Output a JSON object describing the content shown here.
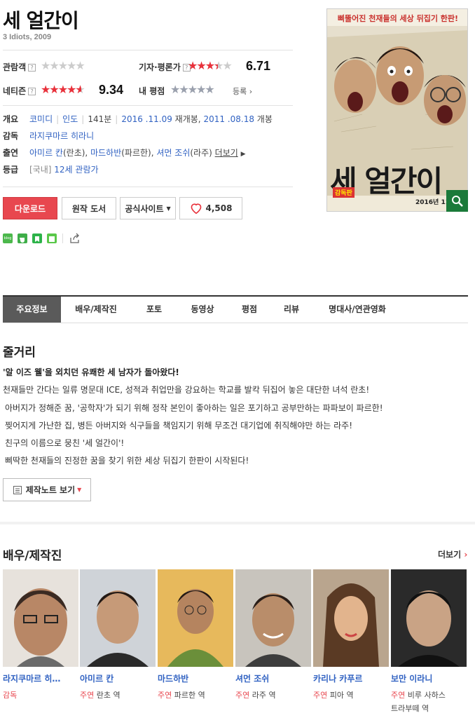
{
  "movie": {
    "title": "세 얼간이",
    "subtitle": "3 Idiots, 2009"
  },
  "ratings": {
    "audience_label": "관람객",
    "audience_q": "?",
    "critic_label": "기자·평론가",
    "critic_q": "?",
    "critic_score": "6.71",
    "critic_stars": 3.5,
    "netizen_label": "네티즌",
    "netizen_q": "?",
    "netizen_score": "9.34",
    "netizen_stars": 4.7,
    "my_label": "내 평점",
    "register": "등록"
  },
  "info": {
    "overview_label": "개요",
    "genre": "코미디",
    "country": "인도",
    "runtime": "141분",
    "release1": "2016 .11.09",
    "release1_suffix": "재개봉,",
    "release2": "2011 .08.18",
    "release2_suffix": "개봉",
    "director_label": "감독",
    "director": "라지쿠마르 히라니",
    "cast_label": "출연",
    "cast1": "아미르 칸",
    "cast1_role": "(란초),",
    "cast2": "마드하반",
    "cast2_role": "(파르한),",
    "cast3": "셔먼 조쉬",
    "cast3_role": "(라주)",
    "more": "더보기",
    "rating_label": "등급",
    "rating_country": "[국내]",
    "rating": "12세 관람가"
  },
  "buttons": {
    "download": "다운로드",
    "original": "원작 도서",
    "official": "공식사이트",
    "likes": "4,508"
  },
  "share": {
    "blog": "blog"
  },
  "poster": {
    "tagline": "삐뚤어진 천재들의 세상 뒤집기 한판!",
    "title": "세 얼간이",
    "badge": "감독판",
    "date": "2016년 11월"
  },
  "tabs": [
    "주요정보",
    "배우/제작진",
    "포토",
    "동영상",
    "평점",
    "리뷰",
    "명대사/연관영화"
  ],
  "synopsis": {
    "heading": "줄거리",
    "lead": "'알 이즈 웰'을 외치던 유쾌한 세 남자가 돌아왔다!",
    "lines": [
      "천재들만 간다는 일류 명문대 ICE, 성적과 취업만을 강요하는 학교를 발칵 뒤집어 놓은 대단한 녀석 란초!",
      "아버지가 정해준 꿈, '공학자'가 되기 위해 정작 본인이 좋아하는 일은 포기하고 공부만하는 파파보이 파르한!",
      "찢어지게 가난한 집, 병든 아버지와 식구들을 책임지기 위해 무조건 대기업에 취직해야만 하는 라주!",
      "친구의 이름으로 뭉친 '세 얼간이'!",
      "삐딱한 천재들의 진정한 꿈을 찾기 위한 세상 뒤집기 한판이 시작된다!"
    ],
    "notes_button": "제작노트 보기"
  },
  "cast_section": {
    "heading": "배우/제작진",
    "more": "더보기",
    "people": [
      {
        "name": "라지쿠마르 히…",
        "role": "감독",
        "char": ""
      },
      {
        "name": "아미르 칸",
        "role": "주연",
        "char": "란초 역"
      },
      {
        "name": "마드하반",
        "role": "주연",
        "char": "파르한 역"
      },
      {
        "name": "셔먼 조쉬",
        "role": "주연",
        "char": "라주 역"
      },
      {
        "name": "카리나 카푸르",
        "role": "주연",
        "char": "피아 역"
      },
      {
        "name": "보만 이라니",
        "role": "주연",
        "char": "비루 사하스"
      },
      {
        "extra": "트라부떼 역"
      }
    ]
  },
  "colors": {
    "accent": "#e8474f",
    "link": "#3162c2"
  }
}
